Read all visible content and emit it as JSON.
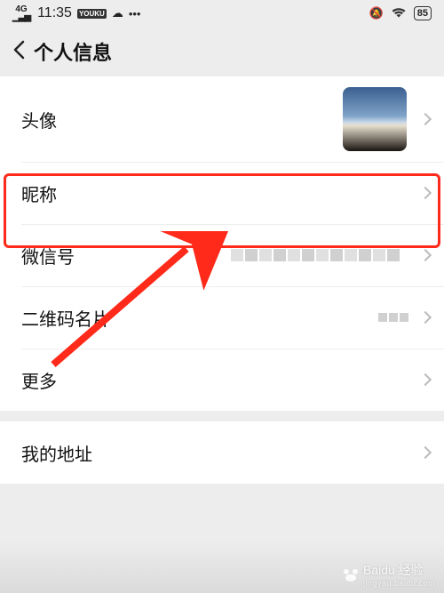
{
  "status": {
    "network": "4G",
    "time": "11:35",
    "battery": "85",
    "badge": "YOUKU",
    "dots": "•••"
  },
  "header": {
    "title": "个人信息"
  },
  "rows": {
    "avatar": {
      "label": "头像"
    },
    "nickname": {
      "label": "昵称"
    },
    "wechat_id": {
      "label": "微信号"
    },
    "qrcode": {
      "label": "二维码名片"
    },
    "more": {
      "label": "更多"
    },
    "address": {
      "label": "我的地址"
    }
  },
  "watermark": {
    "brand": "Baidu 经验",
    "sub": "jingyan.baidu.com"
  }
}
